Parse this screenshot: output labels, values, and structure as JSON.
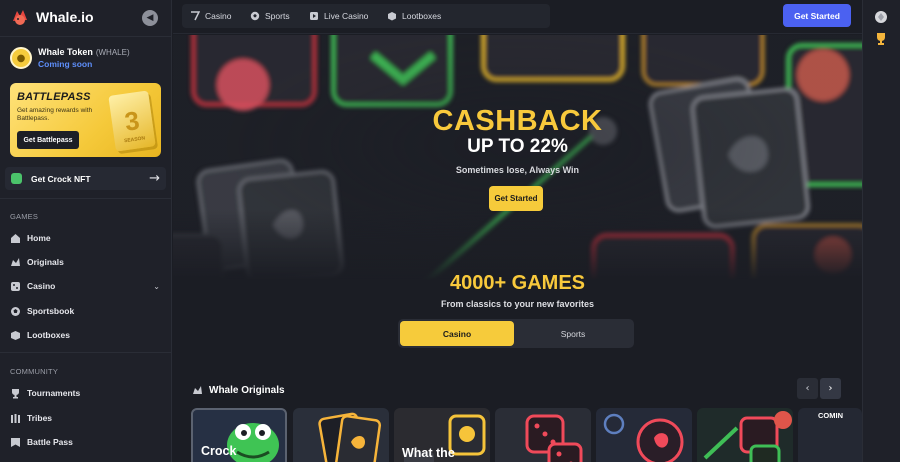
{
  "brand": {
    "name": "Whale.io"
  },
  "token": {
    "name": "Whale Token",
    "symbol": "(WHALE)",
    "status": "Coming soon"
  },
  "battlepass": {
    "title": "BATTLEPASS",
    "description": "Get amazing rewards with Battlepass.",
    "button_label": "Get Battlepass",
    "art_number": "3",
    "art_label": "SEASON"
  },
  "crock_nft": {
    "label": "Get Crock NFT"
  },
  "sidebar": {
    "games_section": "GAMES",
    "games_items": [
      {
        "label": "Home",
        "icon": "home-icon"
      },
      {
        "label": "Originals",
        "icon": "originals-icon"
      },
      {
        "label": "Casino",
        "icon": "dice-icon"
      },
      {
        "label": "Sportsbook",
        "icon": "sports-ball-icon"
      },
      {
        "label": "Lootboxes",
        "icon": "lootbox-icon"
      }
    ],
    "community_section": "COMMUNITY",
    "community_items": [
      {
        "label": "Tournaments",
        "icon": "trophy-icon"
      },
      {
        "label": "Tribes",
        "icon": "tribes-icon"
      },
      {
        "label": "Battle Pass",
        "icon": "battle-pass-icon"
      }
    ]
  },
  "topbar": {
    "tabs": [
      {
        "label": "Casino",
        "icon": "casino-icon"
      },
      {
        "label": "Sports",
        "icon": "sports-ball-icon"
      },
      {
        "label": "Live Casino",
        "icon": "live-casino-icon"
      },
      {
        "label": "Lootboxes",
        "icon": "lootbox-icon"
      }
    ],
    "cta_label": "Get Started"
  },
  "hero": {
    "title": "CASHBACK",
    "subtitle": "UP TO 22%",
    "tagline": "Sometimes lose, Always Win",
    "button_label": "Get Started"
  },
  "games": {
    "title": "4000+ GAMES",
    "subtitle": "From classics to your new favorites",
    "switch": [
      "Casino",
      "Sports"
    ],
    "active": "Casino"
  },
  "originals": {
    "title": "Whale Originals",
    "prev_icon": "chevron-left-icon",
    "next_icon": "chevron-right-icon",
    "cards": [
      {
        "label": "Crock"
      },
      {
        "label": ""
      },
      {
        "label": "What the"
      },
      {
        "label": ""
      },
      {
        "label": ""
      },
      {
        "label": ""
      },
      {
        "label": "COMIN"
      }
    ]
  },
  "colors": {
    "accent_yellow": "#f6cb3b",
    "primary_blue": "#4b61f1",
    "link_blue": "#5e8ffb",
    "background": "#1b1d24",
    "sidebar": "#1f2129"
  }
}
